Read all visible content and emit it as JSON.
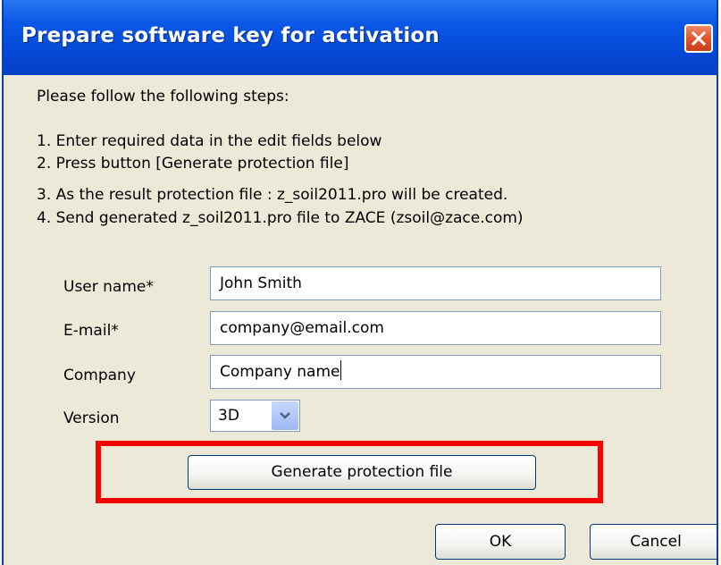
{
  "window": {
    "title": "Prepare software key for activation",
    "close_icon": "close-icon"
  },
  "instructions": {
    "intro": "Please follow the following steps:",
    "steps": [
      "1. Enter required data in the edit fields below",
      "2. Press button [Generate protection file]",
      "3. As the result protection file : z_soil2011.pro will be created.",
      "4. Send generated z_soil2011.pro file to ZACE (zsoil@zace.com)"
    ]
  },
  "form": {
    "user_name": {
      "label": "User name*",
      "value": "John Smith"
    },
    "email": {
      "label": "E-mail*",
      "value": "company@email.com"
    },
    "company": {
      "label": "Company",
      "value": "Company name"
    },
    "version": {
      "label": "Version",
      "value": "3D",
      "arrow_icon": "chevron-down-icon"
    }
  },
  "buttons": {
    "generate": "Generate protection file",
    "ok": "OK",
    "cancel": "Cancel"
  },
  "colors": {
    "titlebar": "#0a58e6",
    "window_bg": "#ece9d8",
    "highlight": "#ff0000",
    "close_button": "#e0552f"
  }
}
